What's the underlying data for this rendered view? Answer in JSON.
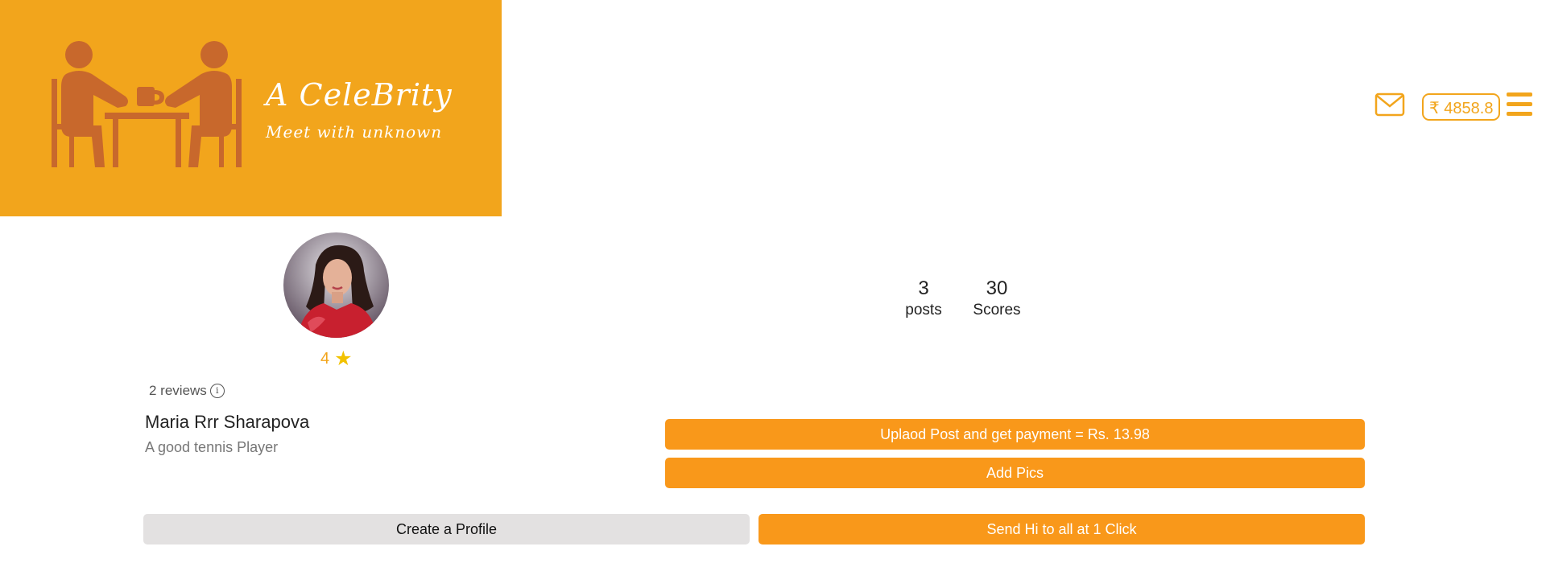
{
  "brand": {
    "title": "A CeleBrity",
    "tagline": "Meet with unknown",
    "color": "#f2a51c"
  },
  "header": {
    "mail_icon": "envelope-icon",
    "wallet_balance": "₹ 4858.8",
    "menu_icon": "hamburger-menu-icon"
  },
  "profile": {
    "rating": "4",
    "rating_icon": "star-icon",
    "reviews": "2 reviews",
    "info_icon": "i",
    "name": "Maria Rrr Sharapova",
    "bio": "A good tennis Player"
  },
  "stats": {
    "posts_count": "3",
    "posts_label": "posts",
    "scores_count": "30",
    "scores_label": "Scores"
  },
  "actions": {
    "upload_label": "Uplaod Post and get payment = Rs. 13.98",
    "add_pics_label": "Add Pics",
    "create_profile_label": "Create a Profile",
    "send_hi_label": "Send Hi to all at 1 Click"
  },
  "colors": {
    "accent": "#f9981a",
    "banner": "#f2a51c",
    "secondary_button": "#e3e1e1",
    "star": "#f2c200"
  }
}
